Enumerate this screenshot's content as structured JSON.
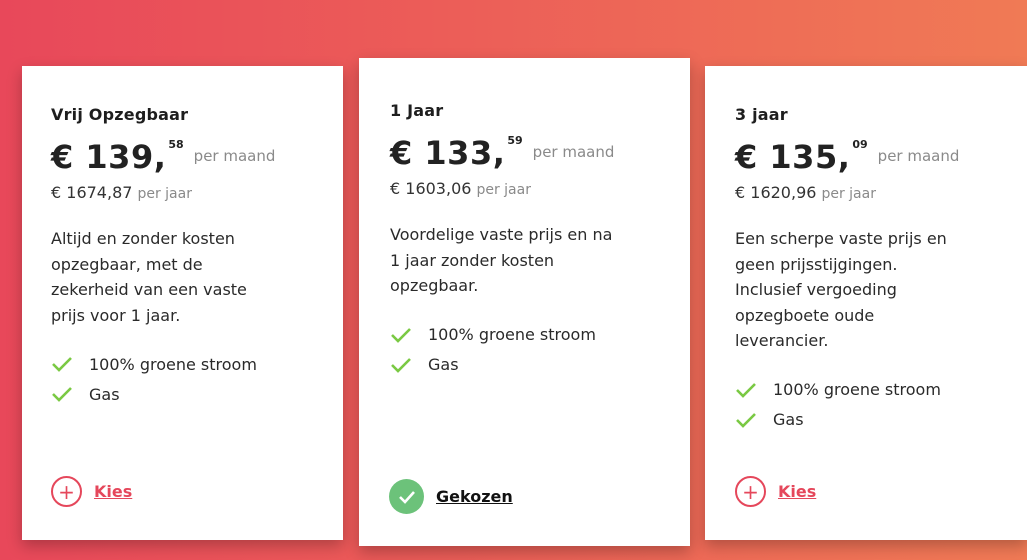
{
  "plans": [
    {
      "name": "Vrij Opzegbaar",
      "price_main": "€ 139,",
      "price_cents": "58",
      "price_period": "per maand",
      "year_amount": "€ 1674,87",
      "year_label": "per jaar",
      "description": "Altijd en zonder kosten opzegbaar, met de zekerheid van een vaste prijs voor 1 jaar.",
      "features": [
        "100% groene stroom",
        "Gas"
      ],
      "action_label": "Kies",
      "selected": false
    },
    {
      "name": "1 Jaar",
      "price_main": "€ 133,",
      "price_cents": "59",
      "price_period": "per maand",
      "year_amount": "€ 1603,06",
      "year_label": "per jaar",
      "description": "Voordelige vaste prijs en na 1 jaar zonder kosten opzegbaar.",
      "features": [
        "100% groene stroom",
        "Gas"
      ],
      "action_label": "Gekozen",
      "selected": true
    },
    {
      "name": "3 jaar",
      "price_main": "€ 135,",
      "price_cents": "09",
      "price_period": "per maand",
      "year_amount": "€ 1620,96",
      "year_label": "per jaar",
      "description": "Een scherpe vaste prijs en geen prijsstijgingen. Inclusief vergoeding opzegboete oude leverancier.",
      "features": [
        "100% groene stroom",
        "Gas"
      ],
      "action_label": "Kies",
      "selected": false
    }
  ],
  "icons": {
    "add": "plus-icon",
    "selected": "checkmark-icon",
    "feature": "check-icon"
  },
  "colors": {
    "accent": "#e5475b",
    "check": "#7ac943",
    "selected": "#6cc27a"
  }
}
